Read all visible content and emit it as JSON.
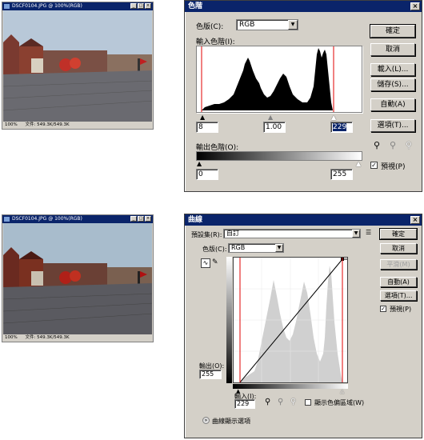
{
  "photo_window": {
    "title": "DSCF0104.JPG @ 100%(RGB)",
    "zoom": "100%",
    "doc_size": "文件: 549.3K/549.3K"
  },
  "levels_dialog": {
    "title": "色階",
    "channel_label": "色版(C):",
    "channel_value": "RGB",
    "input_levels_label": "輸入色階(I):",
    "input_black": "8",
    "input_gamma": "1.00",
    "input_white": "229",
    "output_levels_label": "輸出色階(O):",
    "output_black": "0",
    "output_white": "255",
    "buttons": {
      "ok": "確定",
      "cancel": "取消",
      "load": "載入(L)...",
      "save": "儲存(S)...",
      "auto": "自動(A)",
      "options": "選項(T)..."
    },
    "preview_label": "預視(P)",
    "preview_checked": true
  },
  "curves_dialog": {
    "title": "曲線",
    "preset_label": "預設集(R):",
    "preset_value": "自訂",
    "channel_label": "色版(C):",
    "channel_value": "RGB",
    "output_label": "輸出(O):",
    "output_value": "255",
    "input_label": "輸入(I):",
    "input_value": "229",
    "show_clipping_label": "顯示色偏區域(W)",
    "curve_options_label": "曲線顯示選項",
    "buttons": {
      "ok": "確定",
      "cancel": "取消",
      "smooth": "平滑(M)",
      "auto": "自動(A)",
      "options": "選項(T)..."
    },
    "preview_label": "預視(P)",
    "preview_checked": true
  },
  "icons": {
    "eyedropper_black": "eyedropper-black-icon",
    "eyedropper_gray": "eyedropper-gray-icon",
    "eyedropper_white": "eyedropper-white-icon",
    "curve_tool": "curve-tool-icon",
    "pencil_tool": "pencil-tool-icon",
    "expand": "expand-chevron-icon"
  }
}
